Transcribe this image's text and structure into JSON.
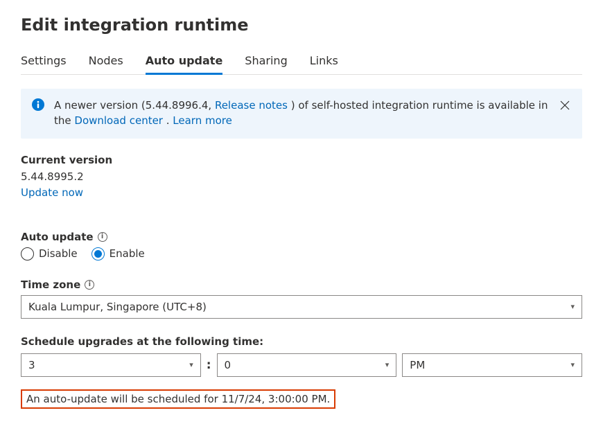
{
  "title": "Edit integration runtime",
  "tabs": [
    "Settings",
    "Nodes",
    "Auto update",
    "Sharing",
    "Links"
  ],
  "active_tab_index": 2,
  "banner": {
    "text1": "A newer version (5.44.8996.4, ",
    "release_notes": "Release notes",
    "text2": " ) of self-hosted integration runtime is available in the ",
    "download_center": "Download center",
    "text3": " . ",
    "learn_more": "Learn more"
  },
  "current_version": {
    "label": "Current version",
    "value": "5.44.8995.2",
    "update_now": "Update now"
  },
  "auto_update": {
    "label": "Auto update",
    "options": {
      "disable": "Disable",
      "enable": "Enable"
    },
    "selected": "enable"
  },
  "timezone": {
    "label": "Time zone",
    "value": "Kuala Lumpur, Singapore (UTC+8)"
  },
  "schedule": {
    "label": "Schedule upgrades at the following time:",
    "hour": "3",
    "minute": "0",
    "ampm": "PM"
  },
  "scheduled_msg": "An auto-update will be scheduled for 11/7/24, 3:00:00 PM."
}
